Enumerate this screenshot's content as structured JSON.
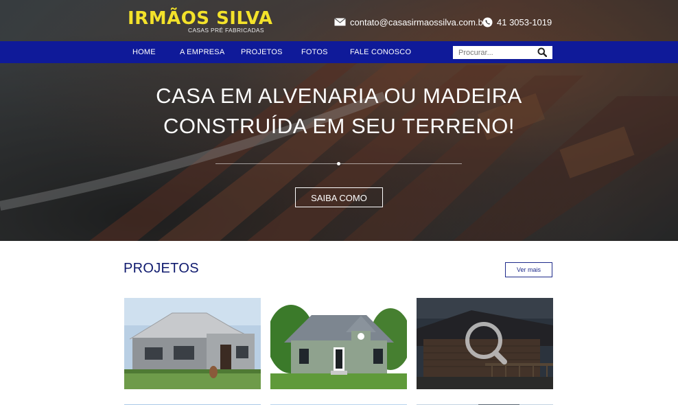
{
  "brand": {
    "name": "IRMÃOS SILVA",
    "tagline": "CASAS PRÉ FABRICADAS"
  },
  "contact": {
    "email": "contato@casasirmaossilva.com.br",
    "phone": "41 3053-1019",
    "email_icon": "envelope-icon",
    "phone_icon": "phone-icon"
  },
  "nav": {
    "items": [
      {
        "label": "HOME"
      },
      {
        "label": "A EMPRESA"
      },
      {
        "label": "PROJETOS"
      },
      {
        "label": "FOTOS"
      },
      {
        "label": "FALE CONOSCO"
      }
    ],
    "search_placeholder": "Procurar...",
    "search_icon": "search-icon"
  },
  "hero": {
    "line1": "CASA EM ALVENARIA OU MADEIRA",
    "line2": "CONSTRUÍDA EM SEU TERRENO!",
    "cta": "SAIBA COMO"
  },
  "projects": {
    "title": "PROJETOS",
    "more": "Ver mais"
  },
  "colors": {
    "brand_yellow": "#f3e22a",
    "nav_blue": "#0f1a99",
    "title_blue": "#0f1a6e"
  }
}
